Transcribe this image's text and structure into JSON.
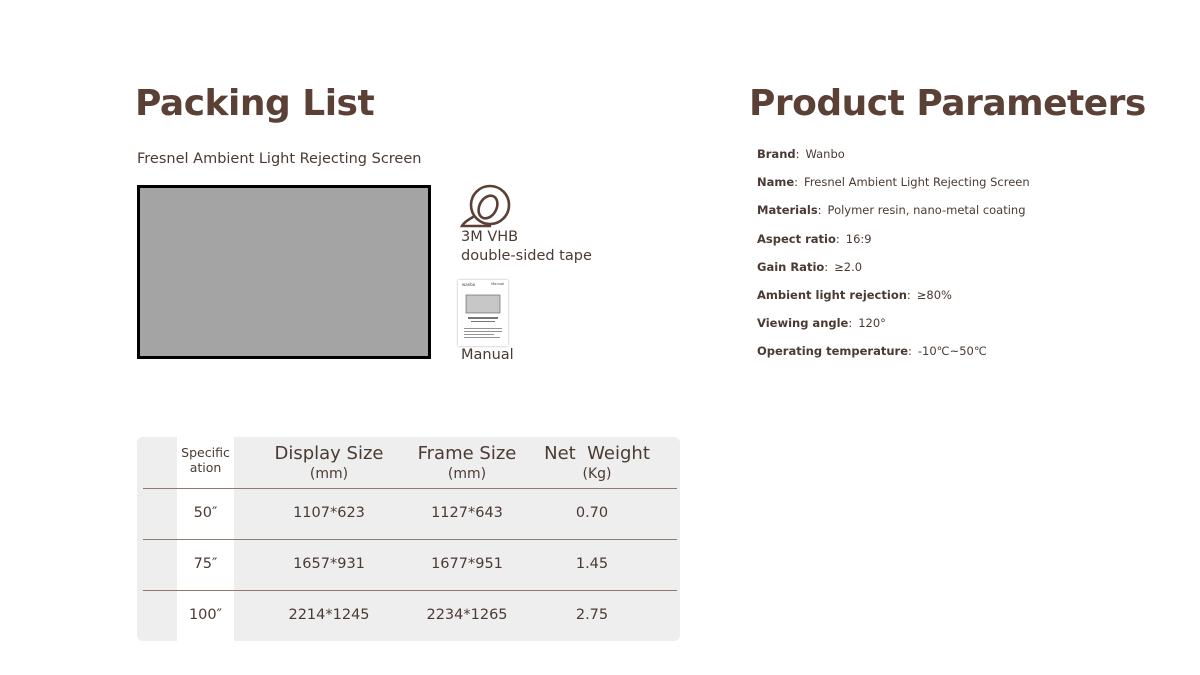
{
  "packing": {
    "title": "Packing List",
    "screen_label": "Fresnel Ambient Light Rejecting Screen",
    "tape_label_line1": "3M VHB",
    "tape_label_line2": "double-sided tape",
    "manual_label": "Manual",
    "manual_brand": "wanbo",
    "manual_word": "Manual"
  },
  "parameters": {
    "title": "Product Parameters",
    "items": [
      {
        "name": "Brand",
        "value": "Wanbo"
      },
      {
        "name": "Name",
        "value": "Fresnel Ambient Light Rejecting Screen"
      },
      {
        "name": "Materials",
        "value": "Polymer resin, nano-metal coating"
      },
      {
        "name": "Aspect ratio",
        "value": "16:9"
      },
      {
        "name": "Gain Ratio",
        "value": "≥2.0"
      },
      {
        "name": "Ambient light rejection",
        "value": "≥80%"
      },
      {
        "name": "Viewing angle",
        "value": "120°"
      },
      {
        "name": "Operating temperature",
        "value": "-10℃~50℃"
      }
    ]
  },
  "table": {
    "spec_header_line1": "Specific",
    "spec_header_line2": "ation",
    "headers": [
      {
        "main": "Display Size",
        "sub": "(mm)"
      },
      {
        "main": "Frame Size",
        "sub": "(mm)"
      },
      {
        "main": "Net  Weight",
        "sub": "(Kg)"
      }
    ],
    "rows": [
      {
        "spec": "50″",
        "display": "1107*623",
        "frame": "1127*643",
        "weight": "0.70"
      },
      {
        "spec": "75″",
        "display": "1657*931",
        "frame": "1677*951",
        "weight": "1.45"
      },
      {
        "spec": "100″",
        "display": "2214*1245",
        "frame": "2234*1265",
        "weight": "2.75"
      }
    ]
  }
}
